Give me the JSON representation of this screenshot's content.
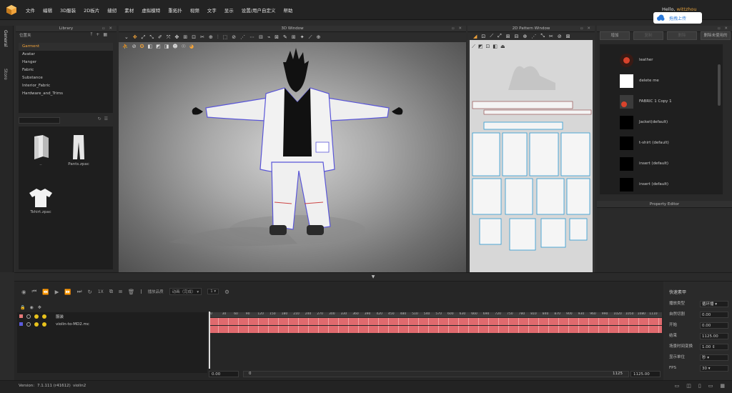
{
  "app": {
    "logo_icon": "clo-cube-icon",
    "accent": "#f0a23a"
  },
  "menu": [
    "文件",
    "编辑",
    "3D服装",
    "2D板片",
    "缝纫",
    "素材",
    "虚拟模特",
    "重拓扑",
    "视频",
    "文字",
    "显示",
    "设置/用户自定义",
    "帮助"
  ],
  "user": {
    "greeting": "Hello,",
    "name": "wittzhou"
  },
  "upload_button": {
    "label": "拖拽上传",
    "icon": "cloud-upload-icon"
  },
  "side_tabs": [
    "General",
    "Store"
  ],
  "library": {
    "title": "Library",
    "path": "位置夹",
    "tree": [
      "Garment",
      "Avatar",
      "Hanger",
      "Fabric",
      "Substance",
      "Interior_Fabric",
      "Hardware_and_Trims"
    ],
    "files": [
      {
        "name": "..",
        "icon": "folder-icon"
      },
      {
        "name": "Pants.zpac",
        "icon": "pants-icon"
      },
      {
        "name": "Tshirt.zpac",
        "icon": "tshirt-icon"
      }
    ]
  },
  "view3d": {
    "title": "3D Window"
  },
  "view2d": {
    "title": "2D Pattern Window"
  },
  "object_browser": {
    "buttons": [
      "增加",
      "复制",
      "删除",
      "删除未使用的"
    ],
    "fabrics": [
      {
        "name": "leather",
        "swatch": "#3a1a14"
      },
      {
        "name": "delete me",
        "swatch": "#ffffff"
      },
      {
        "name": "FABRIC 1 Copy 1",
        "swatch": "#3b3b3b"
      },
      {
        "name": "Jacket(default)",
        "swatch": "#000000"
      },
      {
        "name": "t-shirt (default)",
        "swatch": "#000000"
      },
      {
        "name": "insert (default)",
        "swatch": "#000000"
      },
      {
        "name": "insert (default)",
        "swatch": "#000000"
      }
    ]
  },
  "property_editor": {
    "title": "Property Editor"
  },
  "animation": {
    "record_label": "播放品质",
    "quality_value": "动画（完成）",
    "speed_value": "1",
    "speed_label": "1X",
    "tracks": [
      {
        "name": "服装",
        "color": "#e57979"
      },
      {
        "name": "violin-to-MD2.mc",
        "color": "#5b5bdc"
      }
    ],
    "ruler_ticks": [
      "0",
      "30",
      "60",
      "90",
      "120",
      "150",
      "180",
      "210",
      "240",
      "270",
      "300",
      "330",
      "360",
      "390",
      "420",
      "450",
      "480",
      "510",
      "540",
      "570",
      "600",
      "630",
      "660",
      "690",
      "720",
      "750",
      "780",
      "810",
      "840",
      "870",
      "900",
      "930",
      "960",
      "990",
      "1020",
      "1050",
      "1080",
      "1110"
    ],
    "time_start": "0.00",
    "range_start": "0",
    "range_end": "1125",
    "time_end": "1125.00"
  },
  "quick_props": {
    "title": "快速素甲",
    "rows": [
      {
        "label": "播放类型",
        "value": "循环播"
      },
      {
        "label": "自然切割",
        "value": "0.00"
      },
      {
        "label": "开始",
        "value": "0.00"
      },
      {
        "label": "结束",
        "value": "1125.00"
      },
      {
        "label": "场景时间变换",
        "value": "1.00"
      },
      {
        "label": "显示单位",
        "value": "秒"
      },
      {
        "label": "FPS",
        "value": "30"
      }
    ]
  },
  "status": {
    "version_label": "Version:",
    "version": "7.1.111 (r41612)",
    "user": "violin2"
  }
}
